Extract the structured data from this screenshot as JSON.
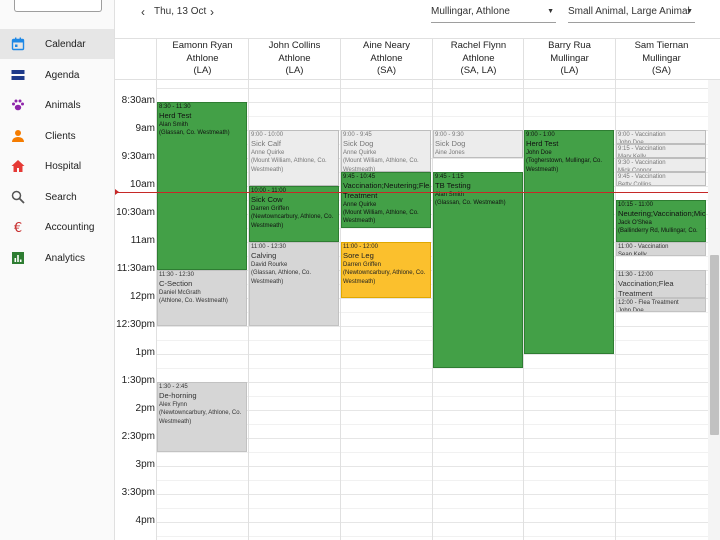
{
  "sidebar": {
    "items": [
      {
        "label": "Calendar",
        "icon": "calendar-icon",
        "color": "#1e88e5",
        "active": true
      },
      {
        "label": "Agenda",
        "icon": "agenda-icon",
        "color": "#1e3a8a"
      },
      {
        "label": "Animals",
        "icon": "paw-icon",
        "color": "#8e24aa"
      },
      {
        "label": "Clients",
        "icon": "person-icon",
        "color": "#f57c00"
      },
      {
        "label": "Hospital",
        "icon": "home-icon",
        "color": "#e53935"
      },
      {
        "label": "Search",
        "icon": "search-icon",
        "color": "#555555"
      },
      {
        "label": "Accounting",
        "icon": "euro-icon",
        "color": "#c62828"
      },
      {
        "label": "Analytics",
        "icon": "bar-chart-icon",
        "color": "#2e7d32"
      }
    ]
  },
  "toolbar": {
    "date": "Thu, 13 Oct",
    "location_select": "Mullingar, Athlone",
    "type_select": "Small Animal, Large Animal"
  },
  "columns": [
    {
      "name": "Eamonn Ryan",
      "location": "Athlone",
      "code": "(LA)"
    },
    {
      "name": "John Collins",
      "location": "Athlone",
      "code": "(LA)"
    },
    {
      "name": "Aine Neary",
      "location": "Athlone",
      "code": "(SA)"
    },
    {
      "name": "Rachel Flynn",
      "location": "Athlone",
      "code": "(SA, LA)"
    },
    {
      "name": "Barry Rua",
      "location": "Mullingar",
      "code": "(LA)"
    },
    {
      "name": "Sam Tiernan",
      "location": "Mullingar",
      "code": "(SA)"
    }
  ],
  "time_labels": [
    "8:30am",
    "9am",
    "9:30am",
    "10am",
    "10:30am",
    "11am",
    "11:30am",
    "12pm",
    "12:30pm",
    "1pm",
    "1:30pm",
    "2pm",
    "2:30pm",
    "3pm",
    "3:30pm",
    "4pm"
  ],
  "appointments": [
    {
      "col": 0,
      "start": 8.5,
      "end": 11.5,
      "style": "green",
      "time": "8:30 - 11:30",
      "title": "Herd Test",
      "client": "Alan Smith",
      "address": "(Glassan, Co. Westmeath)"
    },
    {
      "col": 0,
      "start": 11.5,
      "end": 12.5,
      "style": "grey",
      "time": "11:30 - 12:30",
      "title": "C-Section",
      "client": "Daniel McGrath",
      "address": "(Athlone, Co. Westmeath)"
    },
    {
      "col": 0,
      "start": 13.5,
      "end": 14.75,
      "style": "grey",
      "time": "1:30 - 2:45",
      "title": "De-horning",
      "client": "Alex Flynn",
      "address": "(Newtowncarbury, Athlone, Co. Westmeath)"
    },
    {
      "col": 1,
      "start": 9.0,
      "end": 10.0,
      "style": "lgrey",
      "time": "9:00 - 10:00",
      "title": "Sick Calf",
      "client": "Anne Quirke",
      "address": "(Mount William, Athlone, Co. Westmeath)"
    },
    {
      "col": 1,
      "start": 10.0,
      "end": 11.0,
      "style": "green",
      "time": "10:00 - 11:00",
      "title": "Sick Cow",
      "client": "Darren Griffen",
      "address": "(Newtowncarbury, Athlone, Co. Westmeath)"
    },
    {
      "col": 1,
      "start": 11.0,
      "end": 12.5,
      "style": "grey",
      "time": "11:00 - 12:30",
      "title": "Calving",
      "client": "David Rourke",
      "address": "(Glassan, Athlone, Co. Westmeath)"
    },
    {
      "col": 2,
      "start": 9.0,
      "end": 9.75,
      "style": "lgrey",
      "time": "9:00 - 9:45",
      "title": "Sick Dog",
      "client": "Anne Quirke",
      "address": "(Mount William, Athlone, Co. Westmeath)"
    },
    {
      "col": 2,
      "start": 9.75,
      "end": 10.75,
      "style": "green",
      "time": "9:45 - 10:45",
      "title": "Vaccination;Neutering;Flea Treatment",
      "client": "Anne Quirke",
      "address": "(Mount William, Athlone, Co. Westmeath)"
    },
    {
      "col": 2,
      "start": 11.0,
      "end": 12.0,
      "style": "orange",
      "time": "11:00 - 12:00",
      "title": "Sore Leg",
      "client": "Darren Griffen",
      "address": "(Newtowncarbury, Athlone, Co. Westmeath)"
    },
    {
      "col": 3,
      "start": 9.0,
      "end": 9.5,
      "style": "lgrey",
      "time": "9:00 - 9:30",
      "title": "Sick Dog",
      "client": "Aine Jones",
      "address": ""
    },
    {
      "col": 3,
      "start": 9.75,
      "end": 13.25,
      "style": "green",
      "time": "9:45 - 1:15",
      "title": "TB Testing",
      "client": "Alan Smith",
      "address": "(Glassan, Co. Westmeath)"
    },
    {
      "col": 4,
      "start": 9.0,
      "end": 13.0,
      "style": "green",
      "time": "9:00 - 1:00",
      "title": "Herd Test",
      "client": "John Doe",
      "address": "(Togherstown, Mullingar, Co. Westmeath)"
    },
    {
      "col": 5,
      "start": 9.0,
      "end": 9.25,
      "style": "lgrey",
      "time": "9:00 - Vaccination",
      "title": "",
      "client": "John Doe",
      "address": ""
    },
    {
      "col": 5,
      "start": 9.25,
      "end": 9.5,
      "style": "lgrey",
      "time": "9:15 - Vaccination",
      "title": "",
      "client": "Mary Kelly",
      "address": ""
    },
    {
      "col": 5,
      "start": 9.5,
      "end": 9.75,
      "style": "lgrey",
      "time": "9:30 - Vaccination",
      "title": "",
      "client": "Mick Connor",
      "address": ""
    },
    {
      "col": 5,
      "start": 9.75,
      "end": 10.0,
      "style": "lgrey",
      "time": "9:45 - Vaccination",
      "title": "",
      "client": "Betty Collins",
      "address": ""
    },
    {
      "col": 5,
      "start": 10.25,
      "end": 11.0,
      "style": "green",
      "time": "10:15 - 11:00",
      "title": "Neutering;Vaccination;Microchip",
      "client": "Jack O'Shea",
      "address": "(Ballinderry Rd, Mullingar, Co."
    },
    {
      "col": 5,
      "start": 11.0,
      "end": 11.25,
      "style": "grey",
      "time": "11:00 - Vaccination",
      "title": "",
      "client": "Sean Kelly",
      "address": ""
    },
    {
      "col": 5,
      "start": 11.5,
      "end": 12.0,
      "style": "grey",
      "time": "11:30 - 12:00",
      "title": "Vaccination;Flea Treatment",
      "client": "",
      "address": ""
    },
    {
      "col": 5,
      "start": 12.0,
      "end": 12.25,
      "style": "grey",
      "time": "12:00 - Flea Treatment",
      "title": "",
      "client": "John Doe",
      "address": ""
    }
  ],
  "current_time": 10.1,
  "colors": {
    "accent_blue": "#1e88e5",
    "appt_green": "#43a047",
    "appt_orange": "#fbc02d",
    "now_line": "#c62828"
  }
}
